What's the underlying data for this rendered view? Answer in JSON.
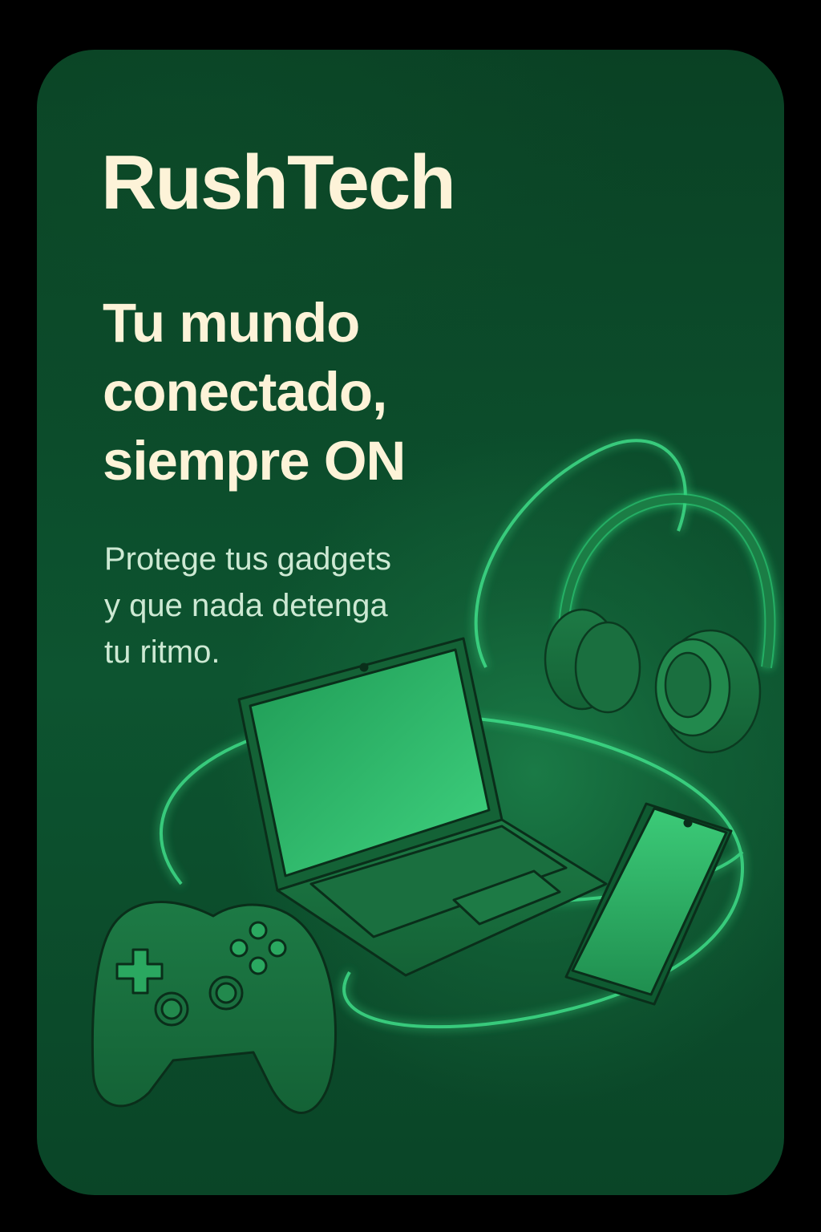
{
  "brand": {
    "name": "RushTech"
  },
  "headline": {
    "lines": [
      "Tu mundo",
      "conectado,",
      "siempre ON"
    ]
  },
  "tagline": {
    "lines": [
      "Protege tus gadgets",
      "y que nada detenga",
      "tu ritmo."
    ]
  },
  "colors": {
    "background": "#0b4a28",
    "text_primary": "#fdf3d8",
    "text_secondary": "#cde9d3",
    "accent_glow": "#3fe08a"
  },
  "illustration": {
    "icons": [
      "headphones-icon",
      "laptop-icon",
      "smartphone-icon",
      "gamepad-icon"
    ]
  }
}
